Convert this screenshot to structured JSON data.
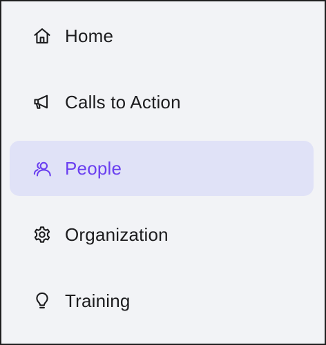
{
  "sidebar": {
    "accent_color": "#6a3ff0",
    "active_background": "#e0e2f7",
    "items": [
      {
        "label": "Home",
        "icon": "home-icon",
        "active": false
      },
      {
        "label": "Calls to Action",
        "icon": "megaphone-icon",
        "active": false
      },
      {
        "label": "People",
        "icon": "people-icon",
        "active": true
      },
      {
        "label": "Organization",
        "icon": "gear-icon",
        "active": false
      },
      {
        "label": "Training",
        "icon": "lightbulb-icon",
        "active": false
      }
    ]
  }
}
